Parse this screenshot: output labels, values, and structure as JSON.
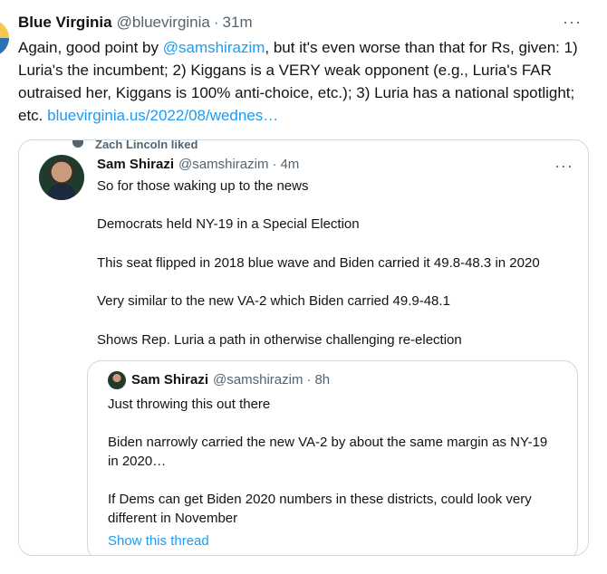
{
  "tweet": {
    "author_name": "Blue Virginia",
    "author_handle": "@bluevirginia",
    "separator": "·",
    "time": "31m",
    "more_label": "···",
    "text_before": "Again, good point by ",
    "mention": "@samshirazim",
    "text_after": ", but it's even worse than that for Rs, given: 1) Luria's the incumbent; 2) Kiggans is a VERY weak opponent (e.g., Luria's FAR outraised her, Kiggans is 100% anti-choice, etc.); 3) Luria has a national spotlight; etc. ",
    "link": "bluevirginia.us/2022/08/wednes…"
  },
  "quote": {
    "social_context": "Zach Lincoln liked",
    "author_name": "Sam Shirazi",
    "author_handle": "@samshirazim",
    "separator": "·",
    "time": "4m",
    "more_label": "···",
    "paragraphs": [
      "So for those waking up to the news",
      "Democrats held NY-19 in a Special Election",
      "This seat flipped in 2018 blue wave and Biden carried it 49.8-48.3 in 2020",
      "Very similar to the new VA-2 which Biden carried 49.9-48.1",
      "Shows Rep. Luria a path in otherwise challenging re-election"
    ]
  },
  "nested": {
    "author_name": "Sam Shirazi",
    "author_handle": "@samshirazim",
    "separator": "·",
    "time": "8h",
    "paragraphs": [
      "Just throwing this out there",
      "Biden narrowly carried the new VA-2 by about the same margin as NY-19 in 2020…",
      "If Dems can get Biden 2020 numbers in these districts, could look very different in November"
    ],
    "show_thread": "Show this thread"
  }
}
